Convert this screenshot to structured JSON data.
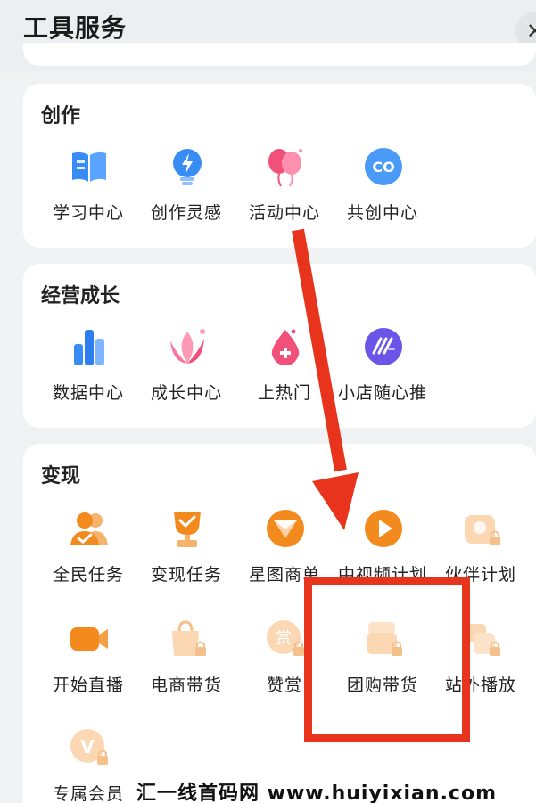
{
  "header": {
    "title": "工具服务",
    "close_icon": "close-icon"
  },
  "sections": [
    {
      "title": "创作",
      "items": [
        {
          "label": "学习中心",
          "icon": "book-icon"
        },
        {
          "label": "创作灵感",
          "icon": "lightbulb-icon"
        },
        {
          "label": "活动中心",
          "icon": "balloon-icon"
        },
        {
          "label": "共创中心",
          "icon": "co-icon"
        }
      ]
    },
    {
      "title": "经营成长",
      "items": [
        {
          "label": "数据中心",
          "icon": "bar-chart-icon"
        },
        {
          "label": "成长中心",
          "icon": "lotus-icon"
        },
        {
          "label": "上热门",
          "icon": "fire-drop-icon"
        },
        {
          "label": "小店随心推",
          "icon": "speed-lines-icon"
        }
      ]
    },
    {
      "title": "变现",
      "items": [
        {
          "label": "全民任务",
          "icon": "people-check-icon"
        },
        {
          "label": "变现任务",
          "icon": "trophy-icon"
        },
        {
          "label": "星图商单",
          "icon": "star-map-icon"
        },
        {
          "label": "中视频计划",
          "icon": "play-icon"
        },
        {
          "label": "伙伴计划",
          "icon": "partner-lock-icon",
          "locked": true
        },
        {
          "label": "开始直播",
          "icon": "video-camera-icon"
        },
        {
          "label": "电商带货",
          "icon": "shopping-bag-lock-icon",
          "locked": true
        },
        {
          "label": "赞赏",
          "icon": "appreciate-lock-icon",
          "locked": true
        },
        {
          "label": "团购带货",
          "icon": "group-buy-lock-icon",
          "locked": true
        },
        {
          "label": "站外播放",
          "icon": "external-play-lock-icon",
          "locked": true
        },
        {
          "label": "专属会员",
          "icon": "vip-lock-icon",
          "locked": true
        }
      ]
    }
  ],
  "icon_glyphs": {
    "co": "CO",
    "appreciate": "赏",
    "vip": "V"
  },
  "colors": {
    "annotation_red": "#e8341c",
    "accent_blue": "#3a8cf5",
    "accent_orange": "#f38a1e",
    "accent_pink": "#f0507a",
    "accent_purple": "#6a55e8"
  },
  "watermark": "汇一线首码网 www.huiyixian.com"
}
